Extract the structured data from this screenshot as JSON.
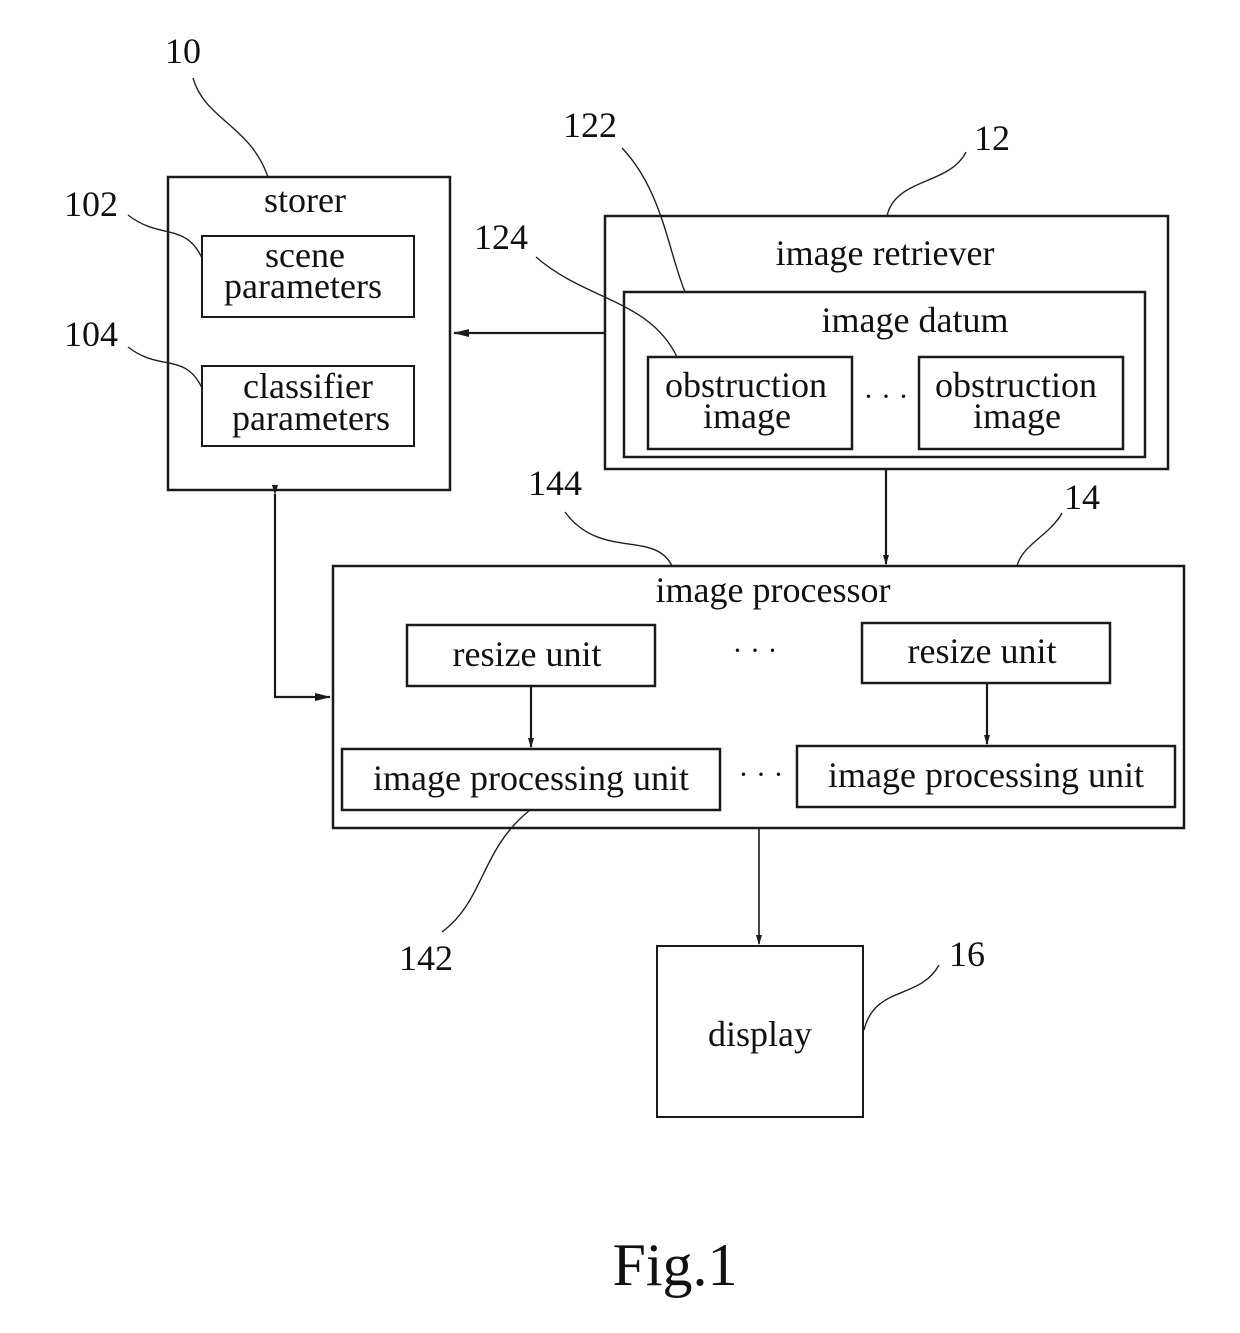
{
  "figure_caption": "Fig.1",
  "blocks": {
    "storer": {
      "ref": "10",
      "title": "storer",
      "scene": {
        "ref": "102",
        "line1": "scene",
        "line2": "parameters"
      },
      "classifier": {
        "ref": "104",
        "line1": "classifier",
        "line2": "parameters"
      }
    },
    "retriever": {
      "ref": "12",
      "title": "image retriever",
      "datum": {
        "ref": "122",
        "title": "image datum",
        "obstruction_ref": "124",
        "items": [
          {
            "line1": "obstruction",
            "line2": "image"
          },
          {
            "line1": "obstruction",
            "line2": "image"
          }
        ],
        "ellipsis": "· · ·"
      }
    },
    "processor": {
      "ref": "14",
      "title": "image processor",
      "resize_ref": "144",
      "processing_ref": "142",
      "resize_units": [
        "resize unit",
        "resize unit"
      ],
      "processing_units": [
        "image processing unit",
        "image processing unit"
      ],
      "ellipsis": "· · ·"
    },
    "display": {
      "ref": "16",
      "title": "display"
    }
  },
  "connections": [
    {
      "from": "image retriever",
      "to": "storer",
      "type": "arrow"
    },
    {
      "from": "image retriever",
      "to": "image processor",
      "type": "arrow"
    },
    {
      "from": "storer",
      "to": "image processor",
      "type": "bidirectional"
    },
    {
      "from": "resize unit",
      "to": "image processing unit",
      "type": "arrow"
    },
    {
      "from": "image processor",
      "to": "display",
      "type": "arrow"
    }
  ]
}
